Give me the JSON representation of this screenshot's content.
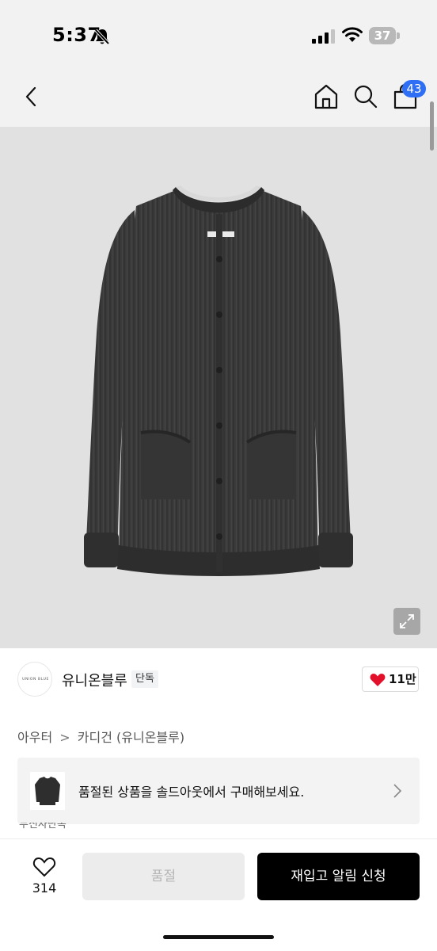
{
  "status_bar": {
    "time": "5:37",
    "battery": "37",
    "icons": [
      "bell-slash-icon",
      "signal-icon",
      "wifi-icon",
      "battery-icon"
    ]
  },
  "nav": {
    "icons": [
      "chevron-left-icon",
      "home-icon",
      "search-icon",
      "shopping-bag-icon"
    ],
    "cart_count": "43"
  },
  "product": {
    "image_description_icon": "product-photo",
    "brand_name": "유니온블루",
    "brand_logo_text": "UNION BLUE",
    "exclusive_badge": "단독",
    "like_count": "11만",
    "breadcrumb": {
      "category": "아우터",
      "separator": ">",
      "subcategory": "카디건 (유니온블루)"
    }
  },
  "banner": {
    "text": "품절된 상품을 솔드아웃에서 구매해보세요.",
    "arrow_icon": "chevron-right-icon"
  },
  "partial_text": "무신사단독",
  "actions": {
    "wish_count": "314",
    "soldout_label": "품절",
    "restock_label": "재입고 알림 신청"
  },
  "colors": {
    "accent_badge": "#2f6ff6",
    "like_heart": "#e3102b",
    "primary_button": "#000000",
    "disabled_button": "#ececec"
  }
}
